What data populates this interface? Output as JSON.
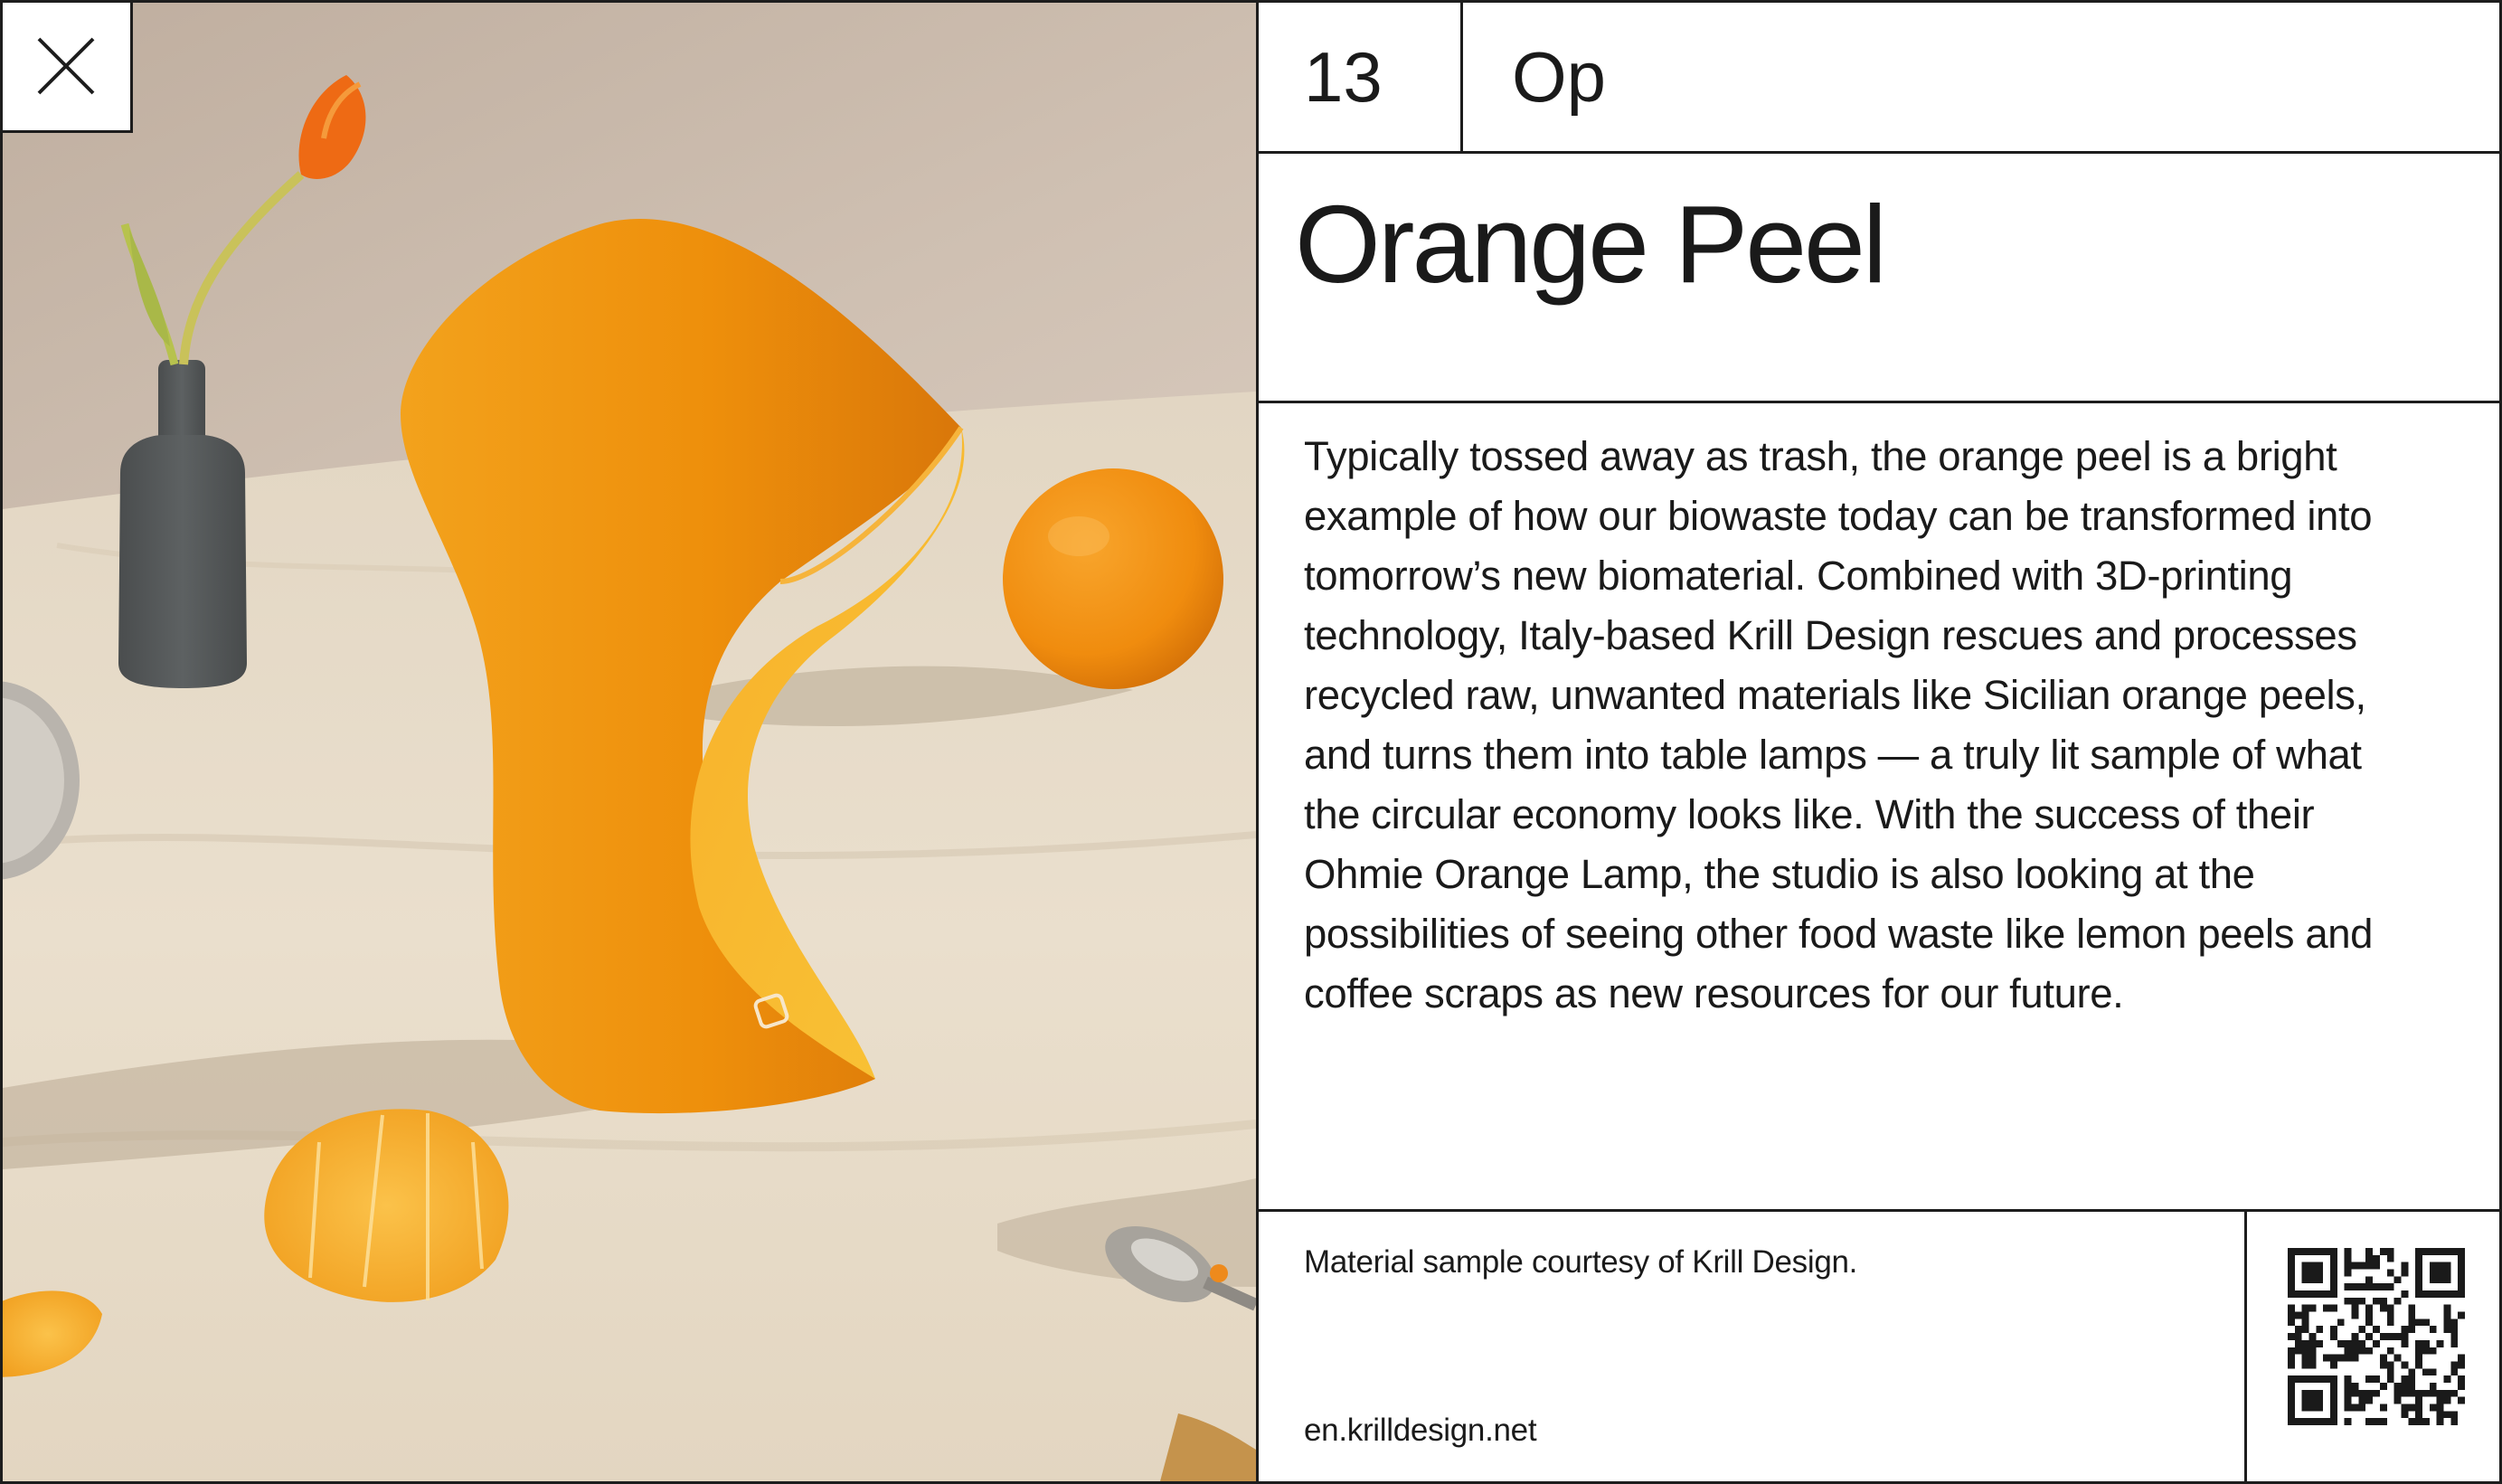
{
  "close_button": {
    "icon": "close-icon"
  },
  "sample": {
    "number": "13",
    "symbol": "Op",
    "title": "Orange Peel",
    "description": "Typically tossed away as trash, the orange peel is a bright example of how our biowaste today can be transformed into tomorrow’s new biomaterial. Combined with 3D-printing technology, Italy-based Krill Design rescues and processes recycled raw, unwanted materials like Sicilian orange peels, and turns them into table lamps — a truly lit sample of what the circular economy looks like. With the success of their Ohmie Orange Lamp, the studio is also looking at the possibilities of seeing other food waste like lemon peels and coffee scraps as new resources for our future."
  },
  "footer": {
    "credit": "Material sample courtesy of Krill Design.",
    "website": "en.krilldesign.net",
    "qr_icon": "qr-code-icon"
  },
  "photo": {
    "subject": "orange-peel-lamp-photo",
    "colors": {
      "wall": "#c9b9ab",
      "table": "#e6dbc9",
      "lamp": "#f0920f",
      "orange": "#f39414",
      "vase": "#56595a"
    }
  }
}
